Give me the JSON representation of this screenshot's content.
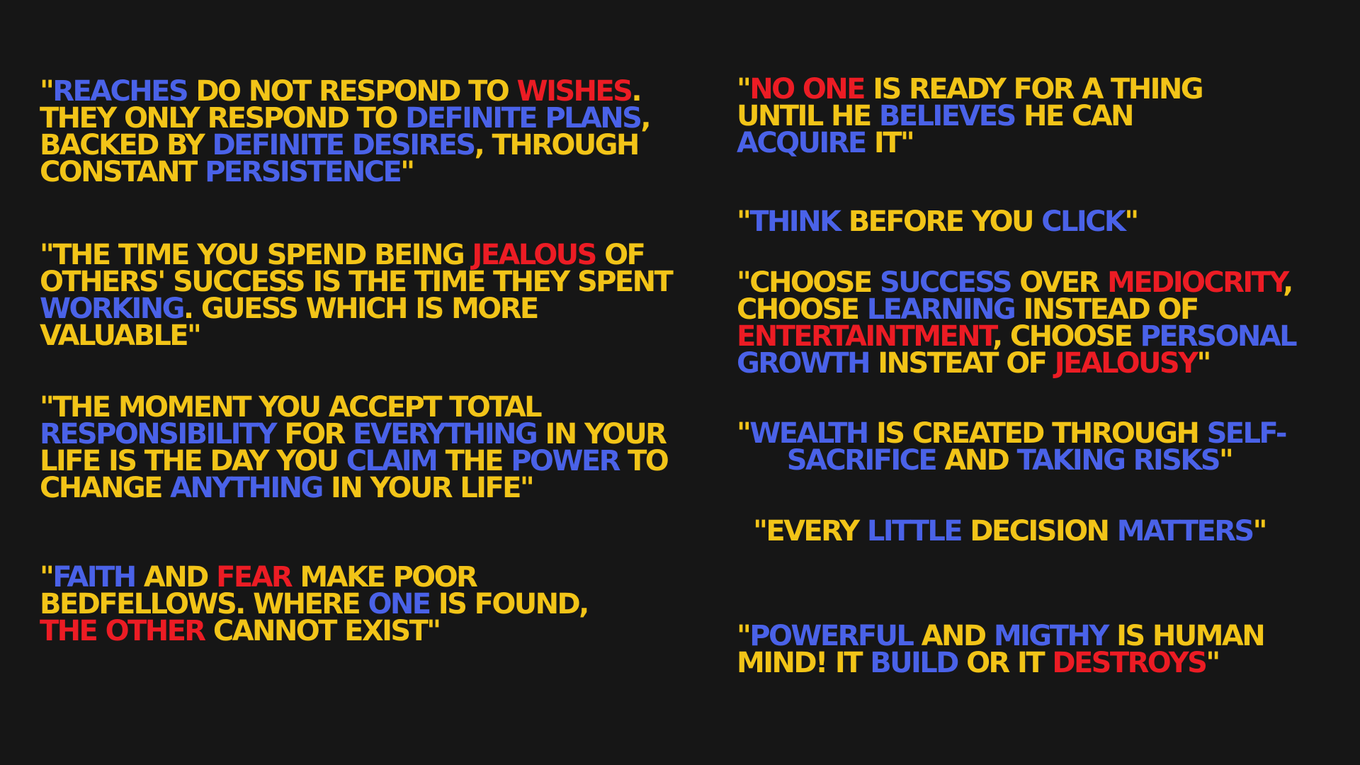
{
  "colors": {
    "background": "#161616",
    "yellow": "#f2c418",
    "blue": "#4a62e8",
    "red": "#ec1c24"
  },
  "quotes": [
    {
      "lines": [
        [
          {
            "t": "\"",
            "c": "y"
          },
          {
            "t": "REACHES",
            "c": "b"
          },
          {
            "t": " DO NOT RESPOND TO ",
            "c": "y"
          },
          {
            "t": "WISHES",
            "c": "r"
          },
          {
            "t": ".",
            "c": "y"
          }
        ],
        [
          {
            "t": "THEY ONLY RESPOND TO ",
            "c": "y"
          },
          {
            "t": "DEFINITE PLANS",
            "c": "b"
          },
          {
            "t": ",",
            "c": "y"
          }
        ],
        [
          {
            "t": "BACKED BY ",
            "c": "y"
          },
          {
            "t": "DEFINITE DESIRES",
            "c": "b"
          },
          {
            "t": ", THROUGH",
            "c": "y"
          }
        ],
        [
          {
            "t": "CONSTANT ",
            "c": "y"
          },
          {
            "t": "PERSISTENCE",
            "c": "b"
          },
          {
            "t": "\"",
            "c": "y"
          }
        ]
      ]
    },
    {
      "lines": [
        [
          {
            "t": "\"THE TIME YOU SPEND BEING ",
            "c": "y"
          },
          {
            "t": "JEALOUS",
            "c": "r"
          },
          {
            "t": " OF",
            "c": "y"
          }
        ],
        [
          {
            "t": "OTHERS' SUCCESS IS THE TIME THEY SPENT",
            "c": "y"
          }
        ],
        [
          {
            "t": "WORKING",
            "c": "b"
          },
          {
            "t": ". GUESS WHICH IS MORE",
            "c": "y"
          }
        ],
        [
          {
            "t": "VALUABLE\"",
            "c": "y"
          }
        ]
      ]
    },
    {
      "lines": [
        [
          {
            "t": "\"THE MOMENT YOU ACCEPT TOTAL",
            "c": "y"
          }
        ],
        [
          {
            "t": "RESPONSIBILITY",
            "c": "b"
          },
          {
            "t": " FOR ",
            "c": "y"
          },
          {
            "t": "EVERYTHING",
            "c": "b"
          },
          {
            "t": " IN YOUR",
            "c": "y"
          }
        ],
        [
          {
            "t": "LIFE IS THE DAY YOU ",
            "c": "y"
          },
          {
            "t": "CLAIM",
            "c": "b"
          },
          {
            "t": " THE ",
            "c": "y"
          },
          {
            "t": "POWER",
            "c": "b"
          },
          {
            "t": " TO",
            "c": "y"
          }
        ],
        [
          {
            "t": "CHANGE ",
            "c": "y"
          },
          {
            "t": "ANYTHING",
            "c": "b"
          },
          {
            "t": " IN YOUR LIFE\"",
            "c": "y"
          }
        ]
      ]
    },
    {
      "lines": [
        [
          {
            "t": "\"",
            "c": "y"
          },
          {
            "t": "FAITH",
            "c": "b"
          },
          {
            "t": " AND ",
            "c": "y"
          },
          {
            "t": "FEAR",
            "c": "r"
          },
          {
            "t": " MAKE POOR",
            "c": "y"
          }
        ],
        [
          {
            "t": "BEDFELLOWS. WHERE ",
            "c": "y"
          },
          {
            "t": "ONE",
            "c": "b"
          },
          {
            "t": " IS FOUND,",
            "c": "y"
          }
        ],
        [
          {
            "t": "THE OTHER",
            "c": "r"
          },
          {
            "t": " CANNOT EXIST\"",
            "c": "y"
          }
        ]
      ]
    },
    {
      "lines": [
        [
          {
            "t": "\"",
            "c": "y"
          },
          {
            "t": "NO ONE",
            "c": "r"
          },
          {
            "t": " IS READY FOR A THING",
            "c": "y"
          }
        ],
        [
          {
            "t": "UNTIL HE ",
            "c": "y"
          },
          {
            "t": "BELIEVES",
            "c": "b"
          },
          {
            "t": " HE CAN",
            "c": "y"
          }
        ],
        [
          {
            "t": "ACQUIRE",
            "c": "b"
          },
          {
            "t": " IT\"",
            "c": "y"
          }
        ]
      ]
    },
    {
      "lines": [
        [
          {
            "t": "\"",
            "c": "y"
          },
          {
            "t": "THINK",
            "c": "b"
          },
          {
            "t": " BEFORE YOU ",
            "c": "y"
          },
          {
            "t": "CLICK",
            "c": "b"
          },
          {
            "t": "\"",
            "c": "y"
          }
        ]
      ]
    },
    {
      "lines": [
        [
          {
            "t": "\"CHOOSE ",
            "c": "y"
          },
          {
            "t": "SUCCESS",
            "c": "b"
          },
          {
            "t": " OVER ",
            "c": "y"
          },
          {
            "t": "MEDIOCRITY",
            "c": "r"
          },
          {
            "t": ",",
            "c": "y"
          }
        ],
        [
          {
            "t": "CHOOSE ",
            "c": "y"
          },
          {
            "t": "LEARNING",
            "c": "b"
          },
          {
            "t": " INSTEAD OF",
            "c": "y"
          }
        ],
        [
          {
            "t": "ENTERTAINTMENT",
            "c": "r"
          },
          {
            "t": ", CHOOSE ",
            "c": "y"
          },
          {
            "t": "PERSONAL",
            "c": "b"
          }
        ],
        [
          {
            "t": "GROWTH",
            "c": "b"
          },
          {
            "t": " INSTEAT OF ",
            "c": "y"
          },
          {
            "t": "JEALOUSY",
            "c": "r"
          },
          {
            "t": "\"",
            "c": "y"
          }
        ]
      ]
    },
    {
      "lines": [
        [
          {
            "t": "\"",
            "c": "y"
          },
          {
            "t": "WEALTH",
            "c": "b"
          },
          {
            "t": " IS CREATED THROUGH ",
            "c": "y"
          },
          {
            "t": "SELF-",
            "c": "b"
          }
        ],
        [
          {
            "t": "SACRIFICE",
            "c": "b"
          },
          {
            "t": " AND ",
            "c": "y"
          },
          {
            "t": "TAKING RISKS",
            "c": "b"
          },
          {
            "t": "\"",
            "c": "y"
          }
        ]
      ]
    },
    {
      "lines": [
        [
          {
            "t": "\"EVERY ",
            "c": "y"
          },
          {
            "t": "LITTLE",
            "c": "b"
          },
          {
            "t": " DECISION ",
            "c": "y"
          },
          {
            "t": "MATTERS",
            "c": "b"
          },
          {
            "t": "\"",
            "c": "y"
          }
        ]
      ]
    },
    {
      "lines": [
        [
          {
            "t": "\"",
            "c": "y"
          },
          {
            "t": "POWERFUL",
            "c": "b"
          },
          {
            "t": " AND ",
            "c": "y"
          },
          {
            "t": "MIGTHY",
            "c": "b"
          },
          {
            "t": " IS HUMAN",
            "c": "y"
          }
        ],
        [
          {
            "t": "MIND! IT ",
            "c": "y"
          },
          {
            "t": "BUILD",
            "c": "b"
          },
          {
            "t": " OR IT ",
            "c": "y"
          },
          {
            "t": "DESTROYS",
            "c": "r"
          },
          {
            "t": "\"",
            "c": "y"
          }
        ]
      ]
    }
  ]
}
